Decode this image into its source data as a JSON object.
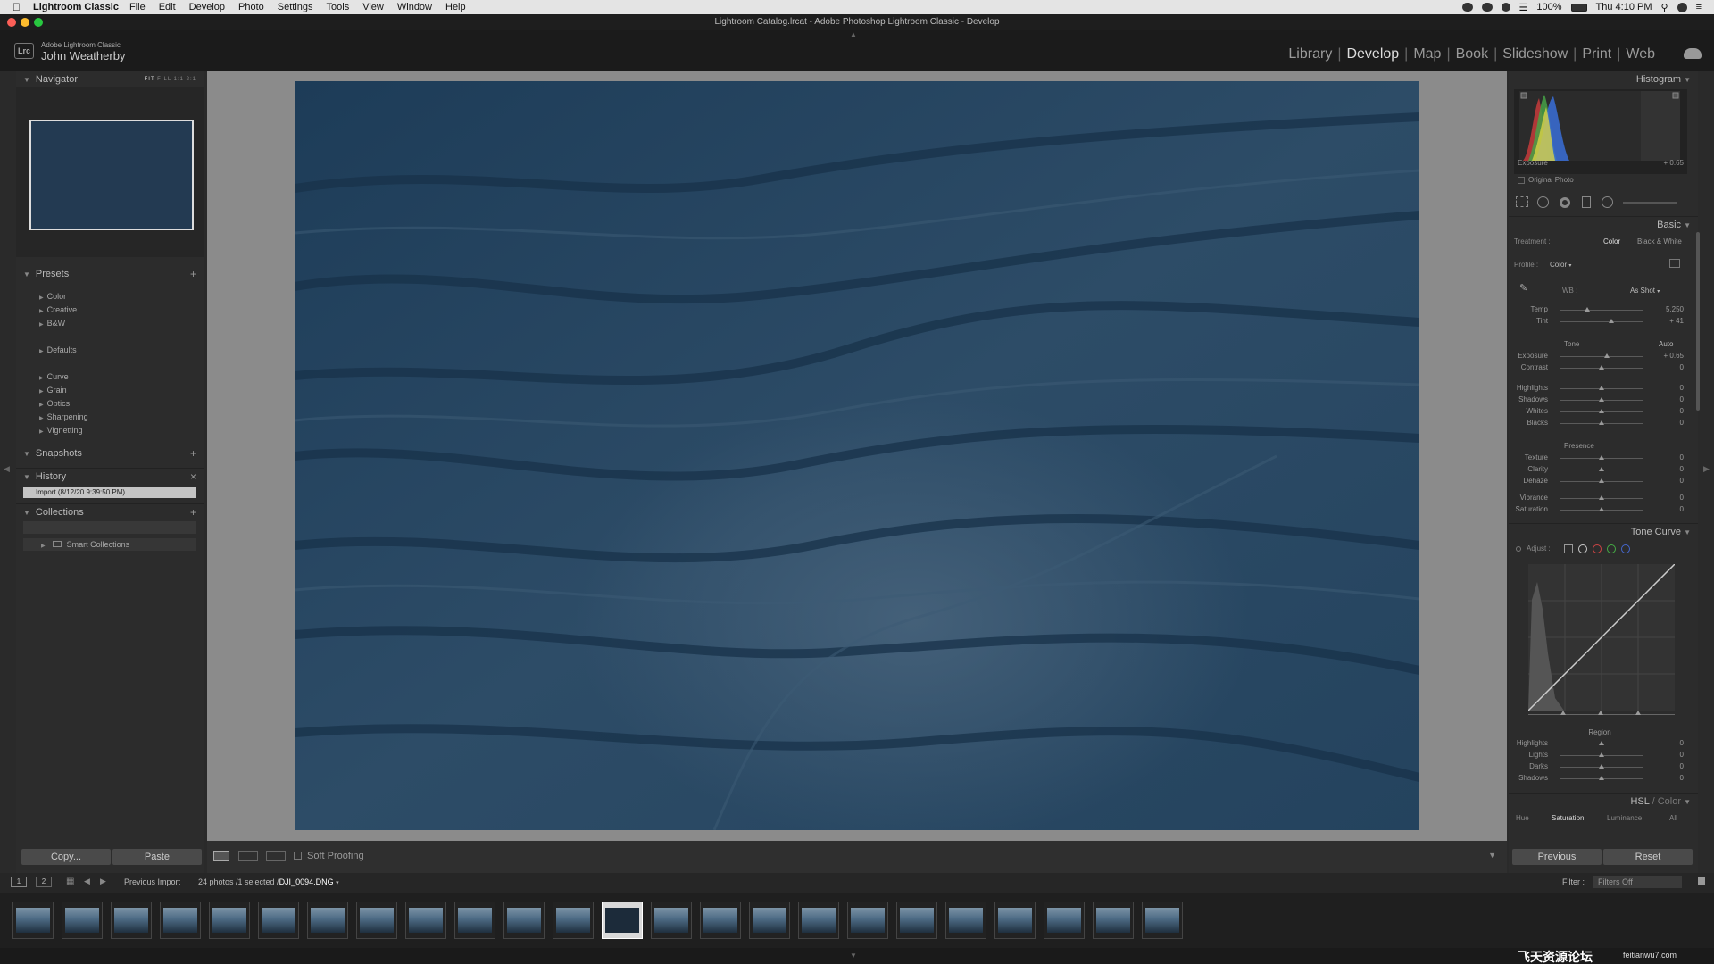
{
  "menubar": {
    "app_name": "Lightroom Classic",
    "items": [
      "File",
      "Edit",
      "Develop",
      "Photo",
      "Settings",
      "Tools",
      "View",
      "Window",
      "Help"
    ],
    "battery": "100%",
    "clock": "Thu 4:10 PM"
  },
  "window": {
    "title": "Lightroom Catalog.lrcat - Adobe Photoshop Lightroom Classic - Develop"
  },
  "identity": {
    "logo": "Lrc",
    "small": "Adobe Lightroom Classic",
    "name": "John Weatherby"
  },
  "modules": {
    "items": [
      "Library",
      "Develop",
      "Map",
      "Book",
      "Slideshow",
      "Print",
      "Web"
    ],
    "active": "Develop"
  },
  "left_panel": {
    "navigator": {
      "title": "Navigator",
      "zoom_options": [
        "FIT",
        "FILL",
        "1:1",
        "2:1"
      ]
    },
    "presets": {
      "title": "Presets",
      "groups": [
        "Color",
        "Creative",
        "B&W",
        "Defaults",
        "Curve",
        "Grain",
        "Optics",
        "Sharpening",
        "Vignetting"
      ]
    },
    "snapshots": {
      "title": "Snapshots"
    },
    "history": {
      "title": "History",
      "items": [
        "Import (8/12/20 9:39:50 PM)"
      ]
    },
    "collections": {
      "title": "Collections",
      "items": [
        "Smart Collections"
      ]
    },
    "copy_label": "Copy...",
    "paste_label": "Paste"
  },
  "toolbar": {
    "soft_proofing": "Soft Proofing"
  },
  "right_panel": {
    "histogram": {
      "title": "Histogram",
      "exposure_label": "Exposure",
      "exposure_value": "+ 0.65",
      "original_photo": "Original Photo"
    },
    "basic": {
      "title": "Basic",
      "treatment_label": "Treatment :",
      "treatment_color": "Color",
      "treatment_bw": "Black & White",
      "profile_label": "Profile :",
      "profile_value": "Color",
      "wb_label": "WB :",
      "wb_value": "As Shot",
      "tone_label": "Tone",
      "auto_label": "Auto",
      "presence_label": "Presence",
      "wb_sliders": [
        {
          "label": "Temp",
          "value": "5,250",
          "pos": 0.33
        },
        {
          "label": "Tint",
          "value": "+ 41",
          "pos": 0.62
        }
      ],
      "tone_sliders": [
        {
          "label": "Exposure",
          "value": "+ 0.65",
          "pos": 0.56
        },
        {
          "label": "Contrast",
          "value": "0",
          "pos": 0.5
        }
      ],
      "tone_sliders2": [
        {
          "label": "Highlights",
          "value": "0",
          "pos": 0.5
        },
        {
          "label": "Shadows",
          "value": "0",
          "pos": 0.5
        },
        {
          "label": "Whites",
          "value": "0",
          "pos": 0.5
        },
        {
          "label": "Blacks",
          "value": "0",
          "pos": 0.5
        }
      ],
      "presence_sliders": [
        {
          "label": "Texture",
          "value": "0",
          "pos": 0.5
        },
        {
          "label": "Clarity",
          "value": "0",
          "pos": 0.5
        },
        {
          "label": "Dehaze",
          "value": "0",
          "pos": 0.5
        }
      ],
      "presence_sliders2": [
        {
          "label": "Vibrance",
          "value": "0",
          "pos": 0.5
        },
        {
          "label": "Saturation",
          "value": "0",
          "pos": 0.5
        }
      ]
    },
    "tone_curve": {
      "title": "Tone Curve",
      "adjust_label": "Adjust :",
      "region_label": "Region",
      "region_sliders": [
        {
          "label": "Highlights",
          "value": "0",
          "pos": 0.5
        },
        {
          "label": "Lights",
          "value": "0",
          "pos": 0.5
        },
        {
          "label": "Darks",
          "value": "0",
          "pos": 0.5
        },
        {
          "label": "Shadows",
          "value": "0",
          "pos": 0.5
        }
      ]
    },
    "hsl": {
      "title_a": "HSL",
      "title_sep": "/",
      "title_b": "Color",
      "tabs": [
        "Hue",
        "Saturation",
        "Luminance",
        "All"
      ],
      "active_tab": "Saturation"
    },
    "previous_label": "Previous",
    "reset_label": "Reset"
  },
  "filmstrip": {
    "source": "Previous Import",
    "count": "24 photos /1 selected /",
    "filename": "DJI_0094.DNG",
    "filter_label": "Filter :",
    "filter_value": "Filters Off",
    "thumbnail_count": 24,
    "selected_index": 12
  },
  "watermark": {
    "cn": "飞天资源论坛",
    "url": "feitianwu7.com"
  },
  "colors": {
    "accent": "#dddddd",
    "panel": "#2c2c2c",
    "photo": "#2c4b66"
  }
}
